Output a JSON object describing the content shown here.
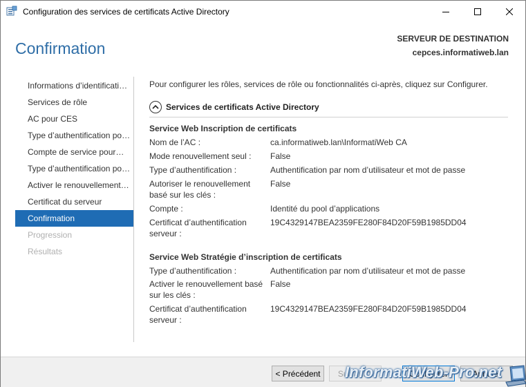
{
  "window": {
    "title": "Configuration des services de certificats Active Directory"
  },
  "header": {
    "page_title": "Confirmation",
    "destination_label": "SERVEUR DE DESTINATION",
    "destination_server": "cepces.informatiweb.lan"
  },
  "nav": {
    "items": [
      {
        "label": "Informations d’identificati…",
        "state": "normal"
      },
      {
        "label": "Services de rôle",
        "state": "normal"
      },
      {
        "label": "AC pour CES",
        "state": "normal"
      },
      {
        "label": "Type d’authentification po…",
        "state": "normal"
      },
      {
        "label": "Compte de service pour…",
        "state": "normal"
      },
      {
        "label": "Type d’authentification po…",
        "state": "normal"
      },
      {
        "label": "Activer le renouvellement…",
        "state": "normal"
      },
      {
        "label": "Certificat du serveur",
        "state": "normal"
      },
      {
        "label": "Confirmation",
        "state": "active"
      },
      {
        "label": "Progression",
        "state": "disabled"
      },
      {
        "label": "Résultats",
        "state": "disabled"
      }
    ]
  },
  "content": {
    "intro": "Pour configurer les rôles, services de rôle ou fonctionnalités ci-après, cliquez sur Configurer.",
    "section_title": "Services de certificats Active Directory",
    "groups": [
      {
        "title": "Service Web Inscription de certificats",
        "rows": [
          {
            "key": "Nom de l’AC :",
            "value": "ca.informatiweb.lan\\InformatiWeb CA"
          },
          {
            "key": "Mode renouvellement seul :",
            "value": "False"
          },
          {
            "key": "Type d’authentification :",
            "value": "Authentification par nom d’utilisateur et mot de passe"
          },
          {
            "key": "Autoriser le renouvellement basé sur les clés :",
            "value": "False"
          },
          {
            "key": "Compte :",
            "value": "Identité du pool d’applications"
          },
          {
            "key": "Certificat d’authentification serveur :",
            "value": "19C4329147BEA2359FE280F84D20F59B1985DD04"
          }
        ]
      },
      {
        "title": "Service Web Stratégie d’inscription de certificats",
        "rows": [
          {
            "key": "Type d’authentification :",
            "value": "Authentification par nom d’utilisateur et mot de passe"
          },
          {
            "key": "Activer le renouvellement basé sur les clés :",
            "value": "False"
          },
          {
            "key": "Certificat d’authentification serveur :",
            "value": "19C4329147BEA2359FE280F84D20F59B1985DD04"
          }
        ]
      }
    ]
  },
  "footer": {
    "prev_label": "< Précédent",
    "next_label": "Suivant >",
    "configure_label": "Configurer",
    "cancel_label": "Annuler"
  },
  "watermark": {
    "text": "InformatiWeb-Pro.net"
  },
  "colors": {
    "accent": "#1f6cb4",
    "title_blue": "#2f6ea7"
  }
}
